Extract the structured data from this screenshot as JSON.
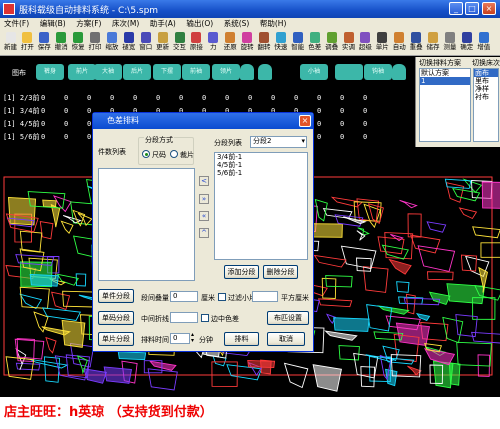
{
  "window": {
    "title": "服科载级自动排料系统 - C:\\5.spm",
    "minimize": "_",
    "maximize": "□",
    "close": "×"
  },
  "menu": [
    "文件(F)",
    "编辑(B)",
    "方案(F)",
    "床次(M)",
    "助手(A)",
    "输出(O)",
    "系统(S)",
    "帮助(H)"
  ],
  "toolbar": [
    {
      "label": "新建",
      "color": "#e6e6e6",
      "icon": "new-file-icon"
    },
    {
      "label": "打开",
      "color": "#f0c040",
      "icon": "folder-open-icon"
    },
    {
      "label": "保存",
      "color": "#3a62c8",
      "icon": "floppy-disk-icon"
    },
    {
      "label": "撤消",
      "color": "#2a9a3a",
      "icon": "undo-icon"
    },
    {
      "label": "恢复",
      "color": "#2a9a3a",
      "icon": "redo-icon"
    },
    {
      "label": "打印",
      "color": "#707070",
      "icon": "printer-icon"
    },
    {
      "label": "缩放",
      "color": "#4a7ad8",
      "icon": "zoom-icon"
    },
    {
      "label": "褪宽",
      "color": "#2a3aa8",
      "icon": "width-icon"
    },
    {
      "label": "窗口",
      "color": "#4a4ab8",
      "icon": "window-icon"
    },
    {
      "label": "更新",
      "color": "#c8a040",
      "icon": "refresh-icon"
    },
    {
      "label": "交互",
      "color": "#308040",
      "icon": "interactive-icon"
    },
    {
      "label": "原接",
      "color": "#d04040",
      "icon": "piece-icon"
    },
    {
      "label": "力",
      "color": "#5a5ad0",
      "icon": "force-icon"
    },
    {
      "label": "还原",
      "color": "#d08030",
      "icon": "restore-icon"
    },
    {
      "label": "旋转",
      "color": "#d040a0",
      "icon": "rotate-icon"
    },
    {
      "label": "翻转",
      "color": "#a05030",
      "icon": "flip-icon"
    },
    {
      "label": "快速",
      "color": "#30a0d0",
      "icon": "fast-icon"
    },
    {
      "label": "智能",
      "color": "#3060c0",
      "icon": "smart-icon"
    },
    {
      "label": "色差",
      "color": "#40b080",
      "icon": "color-diff-icon"
    },
    {
      "label": "调叠",
      "color": "#60a030",
      "icon": "layer-icon"
    },
    {
      "label": "实调",
      "color": "#c06030",
      "icon": "adjust-icon"
    },
    {
      "label": "超级",
      "color": "#8050c0",
      "icon": "super-icon"
    },
    {
      "label": "单片",
      "color": "#404040",
      "icon": "single-piece-icon"
    },
    {
      "label": "自动",
      "color": "#d08030",
      "icon": "auto-icon"
    },
    {
      "label": "重叠",
      "color": "#3050a0",
      "icon": "overlap-icon"
    },
    {
      "label": "储存",
      "color": "#d0a040",
      "icon": "store-icon"
    },
    {
      "label": "测量",
      "color": "#808080",
      "icon": "measure-icon"
    },
    {
      "label": "确定",
      "color": "#3040a0",
      "icon": "confirm-icon"
    },
    {
      "label": "增值",
      "color": "#3070d0",
      "icon": "value-add-icon"
    }
  ],
  "piece_strip": {
    "label": "图布",
    "pieces": [
      "裤身",
      "前片",
      "大袖",
      "后片",
      "下摆",
      "前袖",
      "领片",
      "",
      "",
      "小袖",
      "",
      "钩袖",
      ""
    ]
  },
  "count_rows": [
    {
      "label": "[1] 2/3前",
      "values": [
        "0",
        "0",
        "0",
        "0",
        "0",
        "0",
        "0",
        "0",
        "0",
        "0",
        "0",
        "0",
        "0",
        "0",
        "0"
      ]
    },
    {
      "label": "[1] 3/4前",
      "values": [
        "0",
        "0",
        "0",
        "0",
        "0",
        "0",
        "0",
        "0",
        "0",
        "0",
        "0",
        "0",
        "0",
        "0",
        "0"
      ]
    },
    {
      "label": "[1] 4/5前",
      "values": [
        "0",
        "0",
        "0",
        "0",
        "0",
        "0",
        "0",
        "0",
        "0",
        "0",
        "0",
        "0",
        "0",
        "0",
        "0"
      ]
    },
    {
      "label": "[1] 5/6前",
      "values": [
        "0",
        "0",
        "0",
        "0",
        "0",
        "0",
        "0",
        "0",
        "0",
        "0",
        "0",
        "0",
        "0",
        "0",
        "0"
      ]
    }
  ],
  "right_panel": {
    "header_left": "切换排料方案",
    "header_right": "切换床次",
    "schemes": [
      "默认方案",
      "1"
    ],
    "bed_list": [
      "面布",
      "里布",
      "净样",
      "衬布"
    ]
  },
  "dialog": {
    "title": "色差排料",
    "piece_list_label": "件数列表",
    "group_label": "分段方式",
    "radio_size": "尺码",
    "radio_piece": "裁片",
    "segment_list_label": "分段列表",
    "segment_select": "分段2",
    "segments": [
      "3/4前-1",
      "4/5前-1",
      "5/6前-1"
    ],
    "add_segment": "添加分段",
    "delete_segment": "删除分段",
    "btn_per_piece": "单件分段",
    "btn_per_size": "单码分段",
    "btn_per_cut": "单片分段",
    "label_overlap": "段间叠量",
    "overlap_value": "0",
    "unit_cm": "厘米",
    "label_filter": "过滤小片",
    "unit_sqcm": "平方厘米",
    "label_middle": "中间折线",
    "label_sidecolor": "边中色差",
    "btn_layout": "布匹设置",
    "label_time": "排料时间",
    "time_value": "0",
    "unit_min": "分钟",
    "btn_run": "排料",
    "btn_cancel": "取消"
  },
  "status": {
    "text": "店主旺旺：h英琼 （支持货到付款）"
  }
}
